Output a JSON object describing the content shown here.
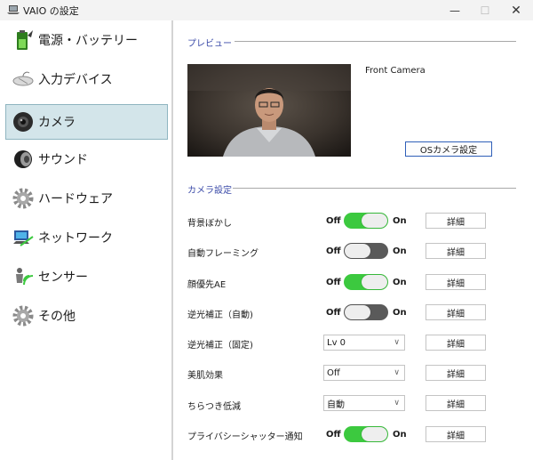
{
  "window": {
    "title": "VAIO の設定",
    "minimize": "—",
    "maximize": "☐",
    "close": "✕"
  },
  "sidebar": {
    "items": [
      {
        "label": "電源・バッテリー",
        "icon": "battery-icon"
      },
      {
        "label": "入力デバイス",
        "icon": "mouse-icon"
      },
      {
        "label": "カメラ",
        "icon": "camera-icon",
        "selected": true
      },
      {
        "label": "サウンド",
        "icon": "speaker-icon"
      },
      {
        "label": "ハードウェア",
        "icon": "gear-icon"
      },
      {
        "label": "ネットワーク",
        "icon": "network-icon"
      },
      {
        "label": "センサー",
        "icon": "sensor-icon"
      },
      {
        "label": "その他",
        "icon": "gear-icon"
      }
    ]
  },
  "preview": {
    "section_title": "プレビュー",
    "camera_name": "Front Camera",
    "os_button": "OSカメラ設定"
  },
  "camera_settings": {
    "section_title": "カメラ設定",
    "off_label": "Off",
    "on_label": "On",
    "detail_label": "詳細",
    "rows": [
      {
        "label": "背景ぼかし",
        "control": "toggle",
        "state": "on"
      },
      {
        "label": "自動フレーミング",
        "control": "toggle",
        "state": "off"
      },
      {
        "label": "顔優先AE",
        "control": "toggle",
        "state": "on"
      },
      {
        "label": "逆光補正（自動)",
        "control": "toggle",
        "state": "off"
      },
      {
        "label": "逆光補正（固定)",
        "control": "select",
        "value": "Lv 0"
      },
      {
        "label": "美肌効果",
        "control": "select",
        "value": "Off"
      },
      {
        "label": "ちらつき低減",
        "control": "select",
        "value": "自動"
      },
      {
        "label": "プライバシーシャッター通知",
        "control": "toggle",
        "state": "on"
      }
    ]
  },
  "colors": {
    "accent": "#2f5fb8",
    "section_title": "#3a4aa8",
    "toggle_on": "#3cc93f",
    "toggle_off": "#5a5a5a",
    "selected_bg": "#d3e5ea"
  }
}
